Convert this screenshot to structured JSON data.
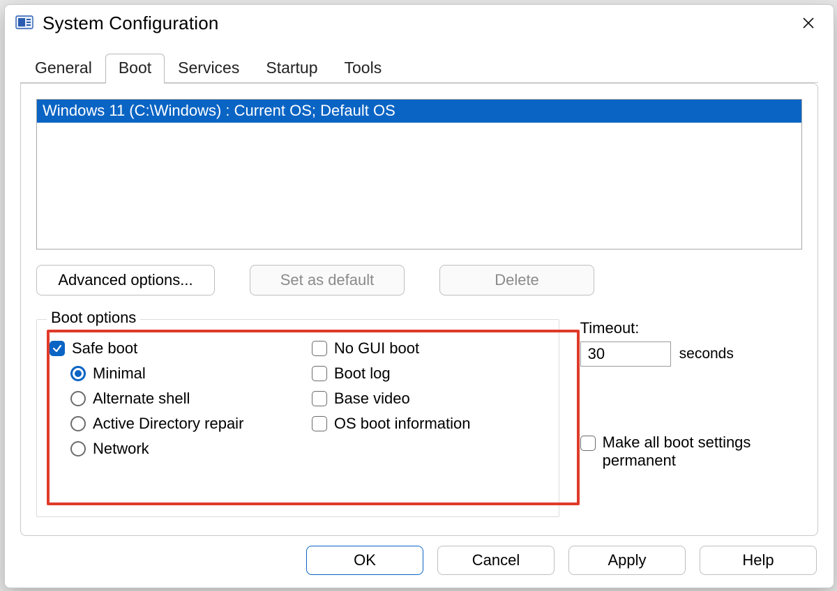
{
  "window": {
    "title": "System Configuration"
  },
  "tabs": {
    "general": "General",
    "boot": "Boot",
    "services": "Services",
    "startup": "Startup",
    "tools": "Tools",
    "active": "boot"
  },
  "boot": {
    "os_entry": "Windows 11 (C:\\Windows) : Current OS; Default OS",
    "buttons": {
      "advanced": "Advanced options...",
      "set_default": "Set as default",
      "delete": "Delete"
    },
    "group_label": "Boot options",
    "safe_boot": {
      "label": "Safe boot",
      "checked": true,
      "modes": {
        "minimal": "Minimal",
        "alternate_shell": "Alternate shell",
        "ad_repair": "Active Directory repair",
        "network": "Network",
        "selected": "minimal"
      }
    },
    "flags": {
      "no_gui": {
        "label": "No GUI boot",
        "checked": false
      },
      "boot_log": {
        "label": "Boot log",
        "checked": false
      },
      "base_video": {
        "label": "Base video",
        "checked": false
      },
      "os_info": {
        "label": "OS boot information",
        "checked": false
      }
    },
    "timeout": {
      "label": "Timeout:",
      "value": "30",
      "unit": "seconds"
    },
    "permanent": {
      "label": "Make all boot settings permanent",
      "checked": false
    }
  },
  "dialog_buttons": {
    "ok": "OK",
    "cancel": "Cancel",
    "apply": "Apply",
    "help": "Help"
  }
}
